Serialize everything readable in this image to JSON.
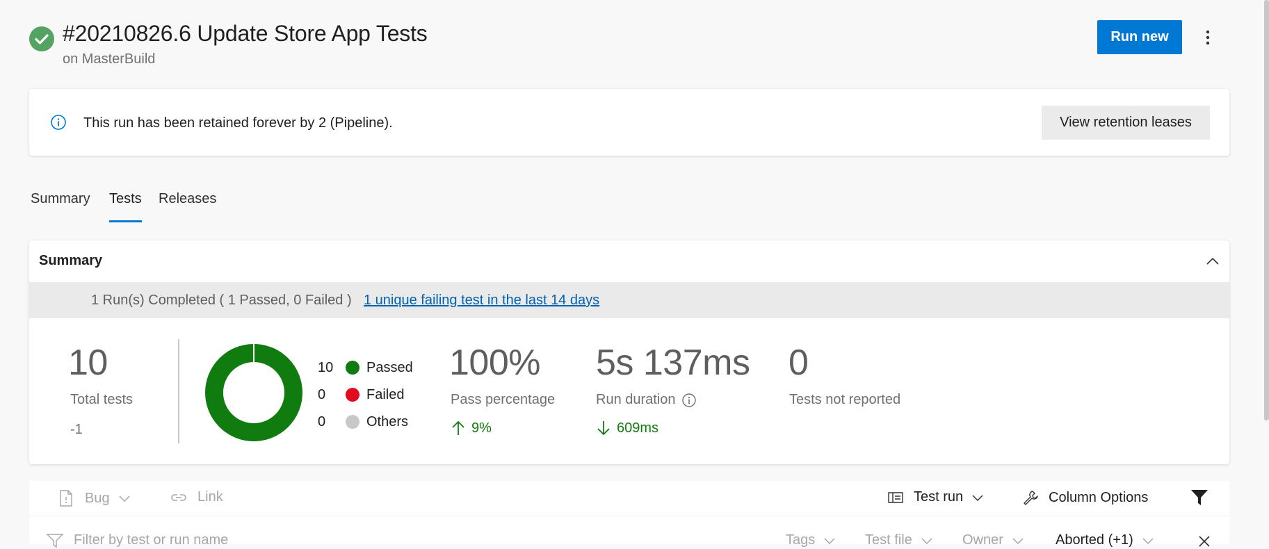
{
  "header": {
    "title": "#20210826.6 Update Store App Tests",
    "subtitle": "on MasterBuild",
    "status_icon": "check-circle-icon",
    "status_color": "#55a362",
    "run_new_label": "Run new",
    "more_icon": "more-vertical-icon"
  },
  "banner": {
    "message": "This run has been retained forever by 2 (Pipeline).",
    "button_label": "View retention leases",
    "icon": "info-icon"
  },
  "tabs": [
    {
      "label": "Summary",
      "active": false
    },
    {
      "label": "Tests",
      "active": true
    },
    {
      "label": "Releases",
      "active": false
    }
  ],
  "summary": {
    "title": "Summary",
    "runs_text": "1 Run(s) Completed ( 1 Passed, 0 Failed )",
    "failing_link": "1 unique failing test in the last 14 days",
    "total_tests": {
      "value": "10",
      "label": "Total tests",
      "delta": "-1"
    },
    "legend": [
      {
        "count": "10",
        "label": "Passed",
        "color": "#107c10"
      },
      {
        "count": "0",
        "label": "Failed",
        "color": "#e00b1c"
      },
      {
        "count": "0",
        "label": "Others",
        "color": "#c8c8c8"
      }
    ],
    "pass_percentage": {
      "value": "100%",
      "label": "Pass percentage",
      "delta": "9%"
    },
    "run_duration": {
      "value": "5s 137ms",
      "label": "Run duration",
      "delta": "609ms"
    },
    "not_reported": {
      "value": "0",
      "label": "Tests not reported"
    }
  },
  "chart_data": {
    "type": "pie",
    "categories": [
      "Passed",
      "Failed",
      "Others"
    ],
    "values": [
      10,
      0,
      0
    ],
    "colors": [
      "#107c10",
      "#e00b1c",
      "#c8c8c8"
    ],
    "style": "donut"
  },
  "toolbar": {
    "bug_label": "Bug",
    "link_label": "Link",
    "test_run_label": "Test run",
    "column_options_label": "Column Options"
  },
  "filter": {
    "placeholder": "Filter by test or run name",
    "tags_label": "Tags",
    "test_file_label": "Test file",
    "owner_label": "Owner",
    "outcome_label": "Aborted (+1)"
  }
}
